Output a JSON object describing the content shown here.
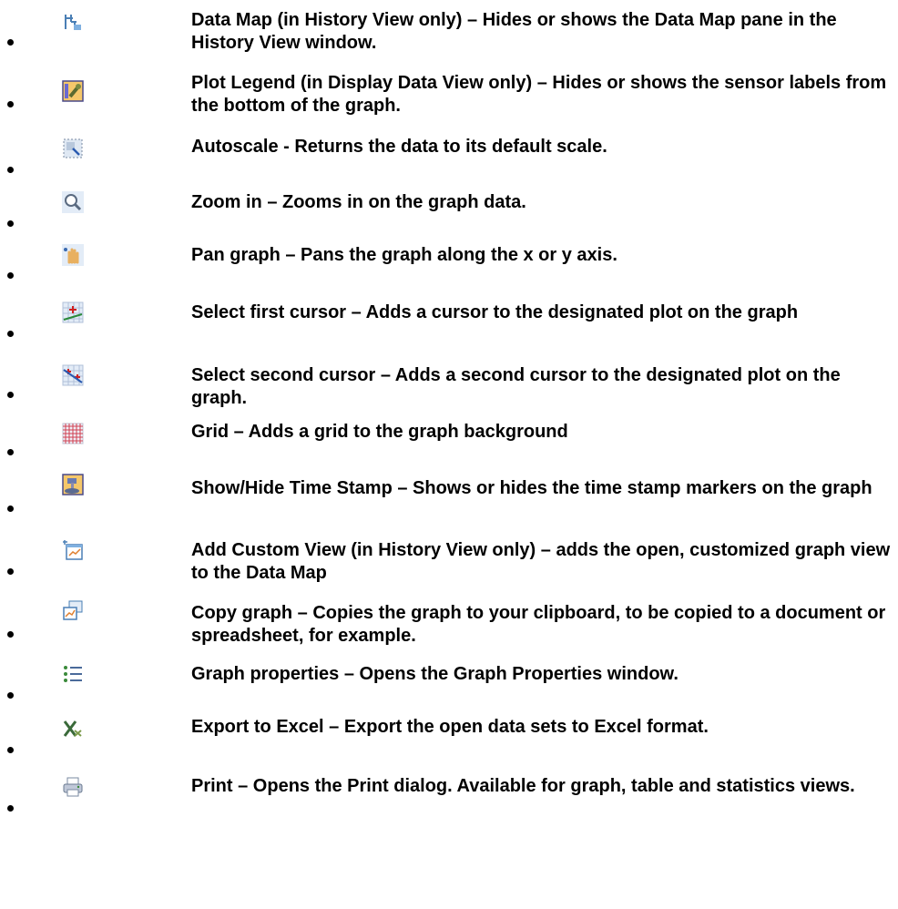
{
  "items": [
    {
      "icon": "data-map-icon",
      "text": "Data Map (in History View only) – Hides or shows the Data Map pane in the History View window."
    },
    {
      "icon": "plot-legend-icon",
      "text": "Plot Legend (in Display Data View only) – Hides or shows the sensor labels from the bottom of the graph."
    },
    {
      "icon": "autoscale-icon",
      "text": "Autoscale - Returns the data to its default scale."
    },
    {
      "icon": "zoom-in-icon",
      "text": "Zoom in – Zooms in on the graph data."
    },
    {
      "icon": "pan-hand-icon",
      "text": "Pan graph – Pans the graph along the x or y axis."
    },
    {
      "icon": "first-cursor-icon",
      "text": "Select first cursor – Adds a cursor to the designated plot on the graph"
    },
    {
      "icon": "second-cursor-icon",
      "text": "Select second cursor – Adds a second cursor to the designated plot on the graph."
    },
    {
      "icon": "grid-icon",
      "text": "Grid – Adds a grid to the graph background"
    },
    {
      "icon": "time-stamp-icon",
      "text": "Show/Hide Time Stamp – Shows or hides the time stamp markers on  the graph"
    },
    {
      "icon": "add-custom-view-icon",
      "text": "Add Custom View (in History View only) – adds the open, customized graph view to the Data Map"
    },
    {
      "icon": "copy-graph-icon",
      "text": "Copy graph – Copies the graph to your clipboard, to be copied to a document or spreadsheet, for example."
    },
    {
      "icon": "graph-properties-icon",
      "text": "Graph properties – Opens the Graph Properties window."
    },
    {
      "icon": "export-excel-icon",
      "text": "Export to Excel – Export the open data sets to Excel format."
    },
    {
      "icon": "print-icon",
      "text": "Print – Opens the Print dialog. Available for graph, table and statistics views."
    }
  ]
}
